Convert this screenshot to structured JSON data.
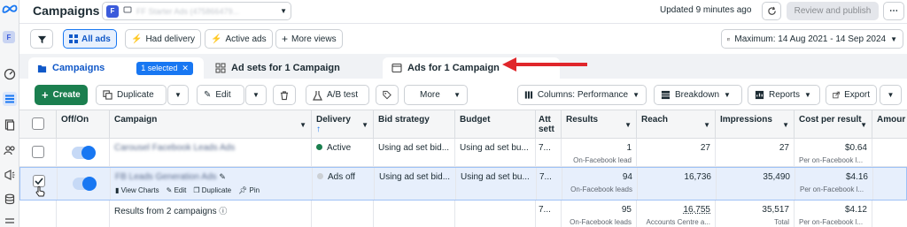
{
  "header": {
    "title": "Campaigns",
    "account_initial": "F",
    "account_name": "FF Starter Ads (475866479...",
    "updated": "Updated 9 minutes ago",
    "review_publish": "Review and publish"
  },
  "filters": {
    "all_ads": "All ads",
    "had_delivery": "Had delivery",
    "active_ads": "Active ads",
    "more_views": "More views",
    "date_range": "Maximum: 14 Aug 2021 - 14 Sep 2024"
  },
  "tabs": {
    "campaigns": "Campaigns",
    "selected": "1 selected",
    "ad_sets": "Ad sets for 1 Campaign",
    "ads": "Ads for 1 Campaign"
  },
  "toolbar": {
    "create": "Create",
    "duplicate": "Duplicate",
    "edit": "Edit",
    "ab_test": "A/B test",
    "more": "More",
    "columns": "Columns: Performance",
    "breakdown": "Breakdown",
    "reports": "Reports",
    "export": "Export"
  },
  "table": {
    "headers": {
      "off_on": "Off/On",
      "campaign": "Campaign",
      "delivery": "Delivery",
      "bid_strategy": "Bid strategy",
      "budget": "Budget",
      "attribution": "Att sett",
      "results": "Results",
      "reach": "Reach",
      "impressions": "Impressions",
      "cost_per_result": "Cost per result",
      "amount": "Amour"
    },
    "rows": [
      {
        "campaign": "Carousel Facebook Leads Ads",
        "delivery": "Active",
        "delivery_color": "#1b7f4f",
        "bid_strategy": "Using ad set bid...",
        "budget": "Using ad set bu...",
        "attribution": "7...",
        "results": "1",
        "results_sub": "On-Facebook lead",
        "reach": "27",
        "impressions": "27",
        "cost_per_result": "$0.64",
        "cost_sub": "Per on-Facebook l..."
      },
      {
        "campaign": "FB Leads Generation Ads",
        "delivery": "Ads off",
        "delivery_color": "#ccd0d5",
        "bid_strategy": "Using ad set bid...",
        "budget": "Using ad set bu...",
        "attribution": "7...",
        "results": "94",
        "results_sub": "On-Facebook leads",
        "reach": "16,736",
        "impressions": "35,490",
        "cost_per_result": "$4.16",
        "cost_sub": "Per on-Facebook l...",
        "actions": {
          "view_charts": "View Charts",
          "edit": "Edit",
          "duplicate": "Duplicate",
          "pin": "Pin"
        }
      }
    ],
    "summary": {
      "label": "Results from 2 campaigns",
      "attribution": "7...",
      "results": "95",
      "results_sub": "On-Facebook leads",
      "reach": "16,755",
      "reach_sub": "Accounts Centre a...",
      "impressions": "35,517",
      "impressions_sub": "Total",
      "cost_per_result": "$4.12",
      "cost_sub": "Per on-Facebook l..."
    }
  },
  "colors": {
    "accent": "#1877f2",
    "create_green": "#1b7f4f",
    "arrow_red": "#e0262b",
    "selected_row": "#e7effc"
  }
}
